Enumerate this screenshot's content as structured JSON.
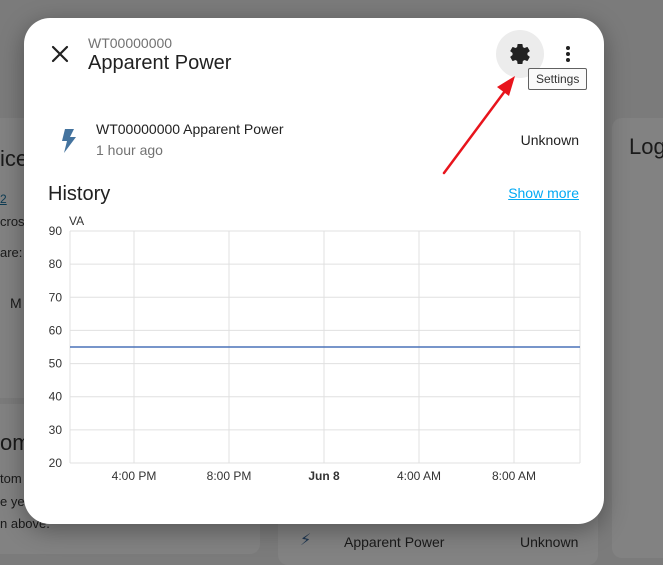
{
  "background": {
    "left_fragments": [
      "ice",
      "2",
      "crose",
      "are:",
      "M",
      "om",
      "tom",
      "e yet.",
      "n above."
    ],
    "right_title": "Log",
    "bottom_row": {
      "name": "Apparent Power",
      "state": "Unknown"
    }
  },
  "dialog": {
    "close_icon": "close-icon",
    "subtitle": "WT00000000",
    "title": "Apparent Power",
    "settings_icon": "gear-icon",
    "more_icon": "more-vert-icon",
    "tooltip": "Settings"
  },
  "entity": {
    "icon": "lightning-bolt-icon",
    "name": "WT00000000 Apparent Power",
    "last_changed": "1 hour ago",
    "state": "Unknown"
  },
  "history": {
    "title": "History",
    "show_more": "Show more"
  },
  "colors": {
    "accent": "#03a9f4",
    "series": "#4a72b8",
    "icon": "#44739e",
    "arrow": "#e8141c"
  },
  "chart_data": {
    "type": "line",
    "ylabel": "VA",
    "ylim": [
      20,
      90
    ],
    "yticks": [
      20,
      30,
      40,
      50,
      60,
      70,
      80,
      90
    ],
    "xticks": [
      {
        "label": "4:00 PM",
        "bold": false
      },
      {
        "label": "8:00 PM",
        "bold": false
      },
      {
        "label": "Jun 8",
        "bold": true
      },
      {
        "label": "4:00 AM",
        "bold": false
      },
      {
        "label": "8:00 AM",
        "bold": false
      }
    ],
    "series": [
      {
        "values": [
          55,
          55
        ]
      }
    ],
    "grid": true
  }
}
